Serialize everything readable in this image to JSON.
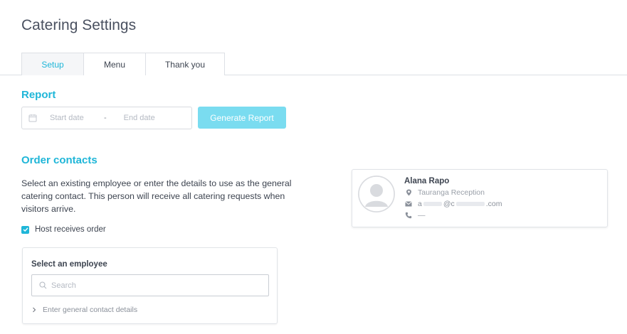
{
  "page": {
    "title": "Catering Settings"
  },
  "tabs": [
    {
      "label": "Setup",
      "active": true
    },
    {
      "label": "Menu",
      "active": false
    },
    {
      "label": "Thank you",
      "active": false
    }
  ],
  "report": {
    "heading": "Report",
    "start_placeholder": "Start date",
    "separator": "-",
    "end_placeholder": "End date",
    "generate_label": "Generate Report"
  },
  "contacts": {
    "heading": "Order contacts",
    "description": "Select an existing employee or enter the details to use as the general catering contact. This person will receive all catering requests when visitors arrive.",
    "host_receives_label": "Host receives order",
    "host_receives_checked": true,
    "select_label": "Select an employee",
    "search_placeholder": "Search",
    "general_link": "Enter general contact details"
  },
  "contact_card": {
    "name": "Alana Rapo",
    "location": "Tauranga Reception",
    "email_start": "a",
    "email_mid": "@c",
    "email_end": ".com",
    "phone": "—"
  },
  "colors": {
    "accent": "#1fb6d8",
    "button_disabled": "#7adcf0",
    "text": "#3d4450",
    "muted": "#9aa0a9"
  },
  "icons": {
    "calendar": "calendar-icon",
    "search": "search-icon",
    "chevron": "chevron-right-icon",
    "location": "map-pin-icon",
    "email": "envelope-icon",
    "phone": "phone-icon",
    "check": "check-icon",
    "avatar": "user-avatar-icon"
  }
}
